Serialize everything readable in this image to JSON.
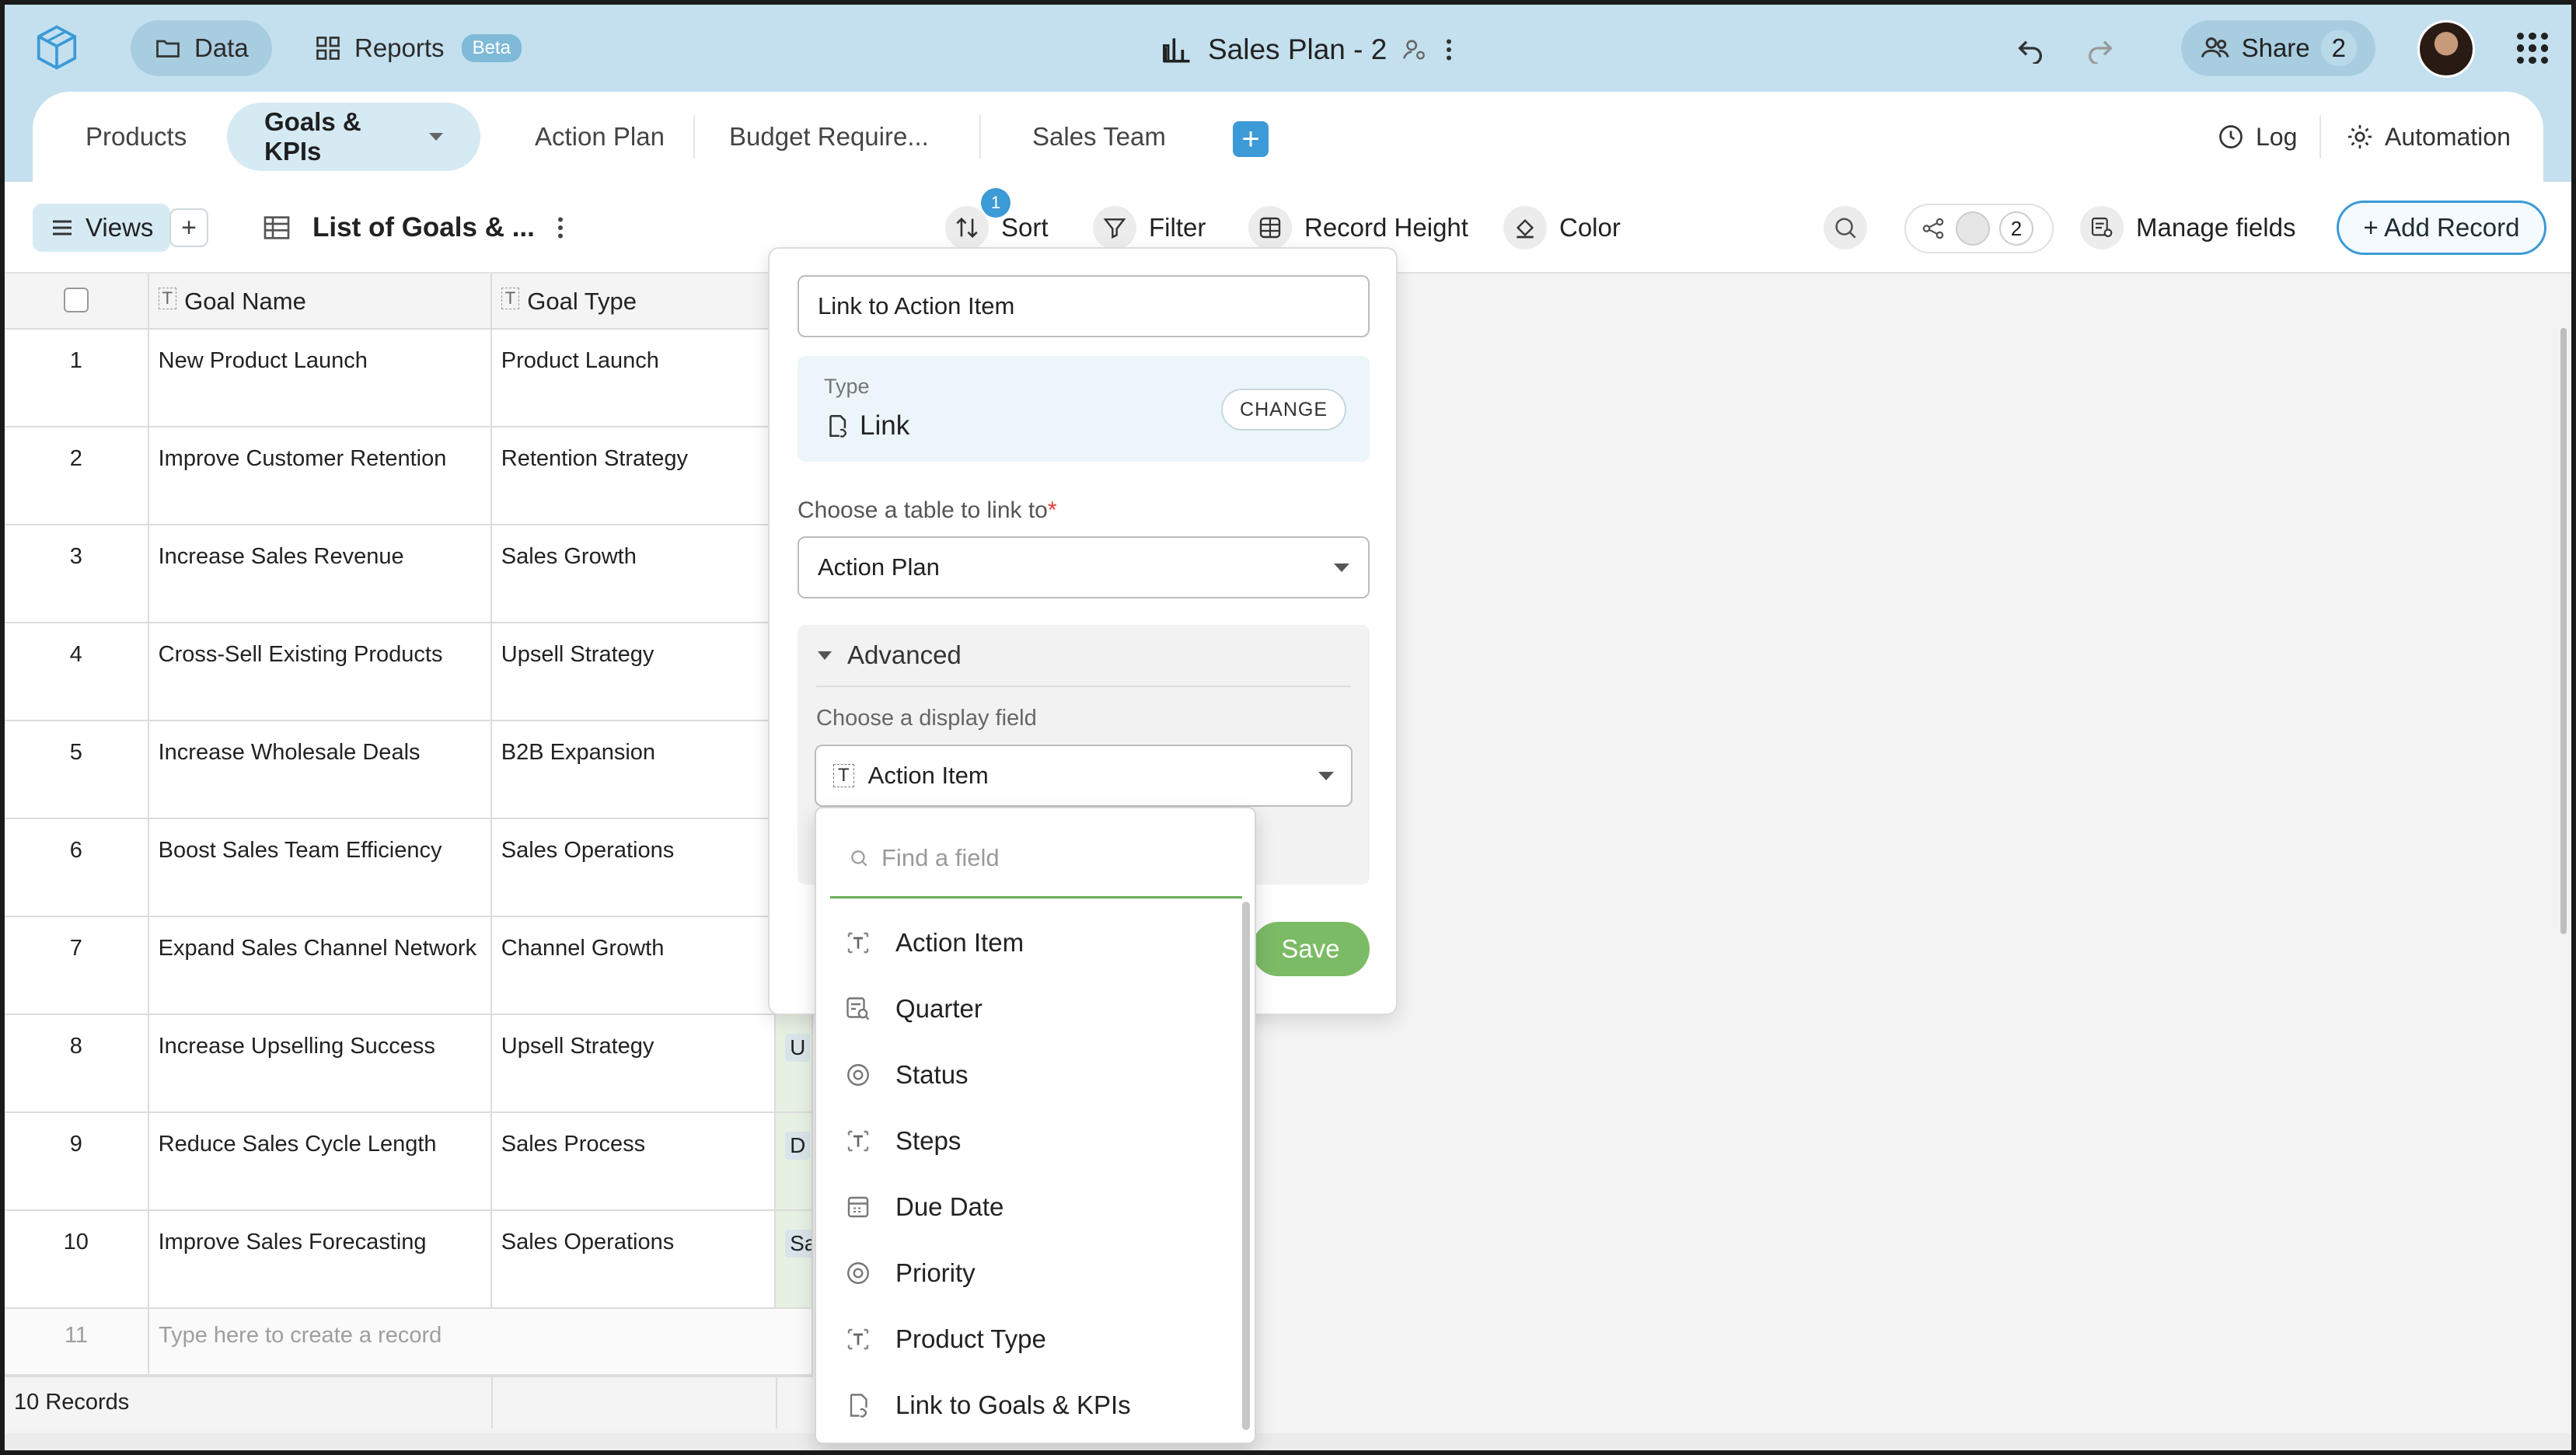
{
  "topbar": {
    "nav": [
      {
        "label": "Data",
        "active": true
      },
      {
        "label": "Reports",
        "badge": "Beta",
        "active": false
      }
    ],
    "doc_title": "Sales Plan - 2",
    "share_label": "Share",
    "share_count": "2"
  },
  "tabs": [
    {
      "label": "Products",
      "active": false
    },
    {
      "label": "Goals & KPIs",
      "active": true
    },
    {
      "label": "Action Plan",
      "active": false
    },
    {
      "label": "Budget Require...",
      "active": false
    },
    {
      "label": "Sales Team",
      "active": false
    }
  ],
  "tab_actions": {
    "log": "Log",
    "automation": "Automation"
  },
  "toolbar": {
    "views": "Views",
    "view_name": "List of Goals & ...",
    "sort": "Sort",
    "sort_badge": "1",
    "filter": "Filter",
    "record_height": "Record Height",
    "color": "Color",
    "collaborator_count": "2",
    "manage_fields": "Manage fields",
    "add_record": "+ Add Record"
  },
  "table": {
    "columns": [
      "Goal Name",
      "Goal Type"
    ],
    "rows": [
      {
        "n": "1",
        "name": "New Product Launch",
        "type": "Product Launch",
        "extra": ""
      },
      {
        "n": "2",
        "name": "Improve Customer Retention",
        "type": "Retention Strategy",
        "extra": ""
      },
      {
        "n": "3",
        "name": "Increase Sales Revenue",
        "type": "Sales Growth",
        "extra": ""
      },
      {
        "n": "4",
        "name": "Cross-Sell Existing Products",
        "type": "Upsell Strategy",
        "extra": ""
      },
      {
        "n": "5",
        "name": "Increase Wholesale Deals",
        "type": "B2B Expansion",
        "extra": ""
      },
      {
        "n": "6",
        "name": "Boost Sales Team Efficiency",
        "type": "Sales Operations",
        "extra": ""
      },
      {
        "n": "7",
        "name": "Expand Sales Channel Network",
        "type": "Channel Growth",
        "extra": ""
      },
      {
        "n": "8",
        "name": "Increase Upselling Success",
        "type": "Upsell Strategy",
        "extra": "U"
      },
      {
        "n": "9",
        "name": "Reduce Sales Cycle Length",
        "type": "Sales Process",
        "extra": "D"
      },
      {
        "n": "10",
        "name": "Improve Sales Forecasting",
        "type": "Sales Operations",
        "extra": "Sa"
      }
    ],
    "new_row_number": "11",
    "new_row_placeholder": "Type here to create a record",
    "record_count": "10 Records"
  },
  "link_field_popup": {
    "field_name": "Link to Action Item",
    "type_label": "Type",
    "type_value": "Link",
    "change_button": "CHANGE",
    "table_label": "Choose a table to link to",
    "required_mark": "*",
    "table_value": "Action Plan",
    "advanced_label": "Advanced",
    "display_field_label": "Choose a display field",
    "display_field_value": "Action Item",
    "save_button": "Save"
  },
  "field_dropdown": {
    "search_placeholder": "Find a field",
    "options": [
      {
        "label": "Action Item",
        "icon": "text-field-icon"
      },
      {
        "label": "Quarter",
        "icon": "lookup-field-icon"
      },
      {
        "label": "Status",
        "icon": "single-select-icon"
      },
      {
        "label": "Steps",
        "icon": "text-field-icon"
      },
      {
        "label": "Due Date",
        "icon": "calendar-icon"
      },
      {
        "label": "Priority",
        "icon": "single-select-icon"
      },
      {
        "label": "Product Type",
        "icon": "text-field-icon"
      },
      {
        "label": "Link to Goals & KPIs",
        "icon": "link-field-icon"
      }
    ]
  },
  "colors": {
    "topbar_bg": "#c4e0ee",
    "accent": "#3c9ad6",
    "save_green": "#7cbb65",
    "active_tab_bg": "#d6eaf4"
  }
}
